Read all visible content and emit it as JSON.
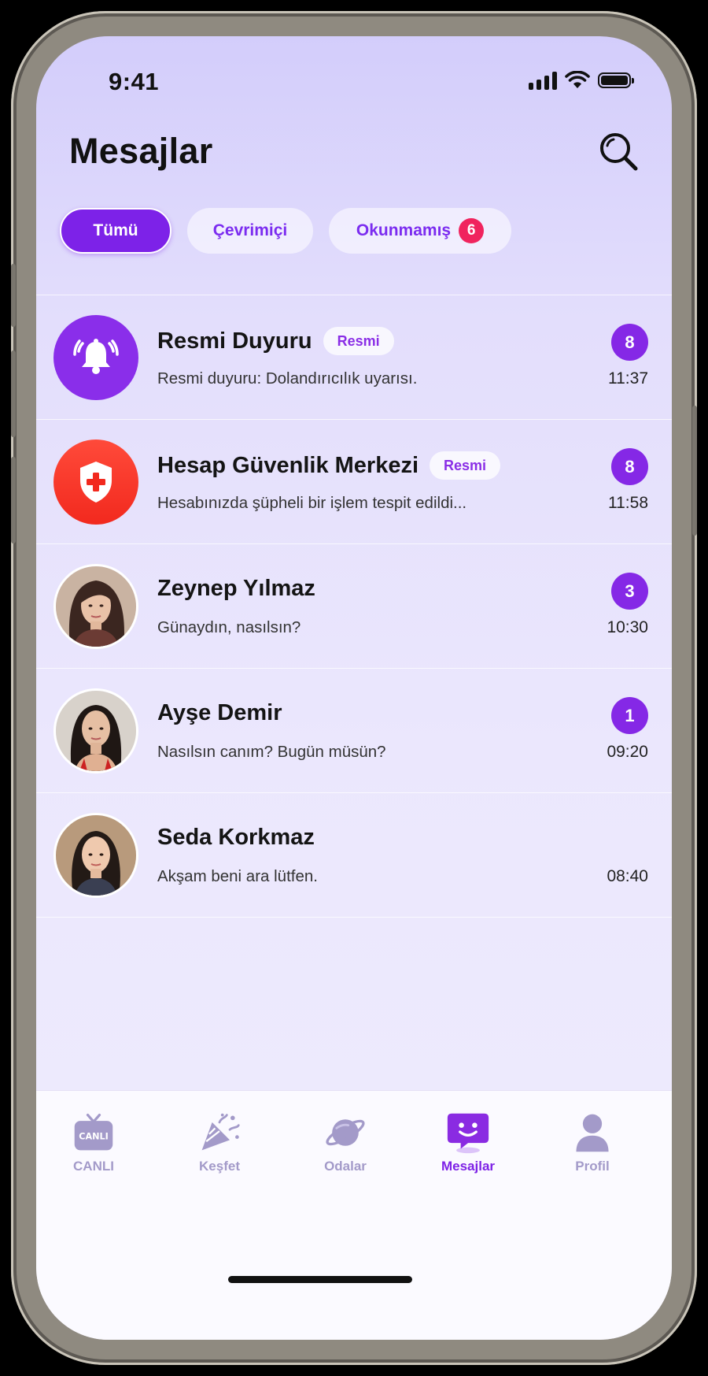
{
  "status": {
    "time": "9:41"
  },
  "header": {
    "title": "Mesajlar"
  },
  "tabs": [
    {
      "label": "Tümü",
      "active": true
    },
    {
      "label": "Çevrimiçi",
      "active": false
    },
    {
      "label": "Okunmamış",
      "active": false,
      "count": "6"
    }
  ],
  "conversations": [
    {
      "name": "Resmi Duyuru",
      "tag": "Resmi",
      "preview": "Resmi duyuru: Dolandırıcılık uyarısı.",
      "unread": "8",
      "time": "11:37",
      "avatar": "bell-icon"
    },
    {
      "name": "Hesap Güvenlik Merkezi",
      "tag": "Resmi",
      "preview": "Hesabınızda şüpheli bir işlem tespit edildi...",
      "unread": "8",
      "time": "11:58",
      "avatar": "shield-icon"
    },
    {
      "name": "Zeynep Yılmaz",
      "preview": "Günaydın, nasılsın?",
      "unread": "3",
      "time": "10:30",
      "avatar": "profile-photo"
    },
    {
      "name": "Ayşe Demir",
      "preview": "Nasılsın canım? Bugün müsün?",
      "unread": "1",
      "time": "09:20",
      "avatar": "profile-photo"
    },
    {
      "name": "Seda Korkmaz",
      "preview": "Akşam beni ara lütfen.",
      "time": "08:40",
      "avatar": "profile-photo"
    }
  ],
  "nav": [
    {
      "label": "CANLI",
      "icon": "live-tv-icon",
      "tv_text": "CANLI"
    },
    {
      "label": "Keşfet",
      "icon": "party-popper-icon"
    },
    {
      "label": "Odalar",
      "icon": "planet-icon"
    },
    {
      "label": "Mesajlar",
      "icon": "chat-smile-icon",
      "active": true
    },
    {
      "label": "Profil",
      "icon": "person-icon"
    }
  ],
  "colors": {
    "accent": "#7d22e8",
    "badge_red": "#f0245e",
    "security_red": "#f2291e"
  }
}
